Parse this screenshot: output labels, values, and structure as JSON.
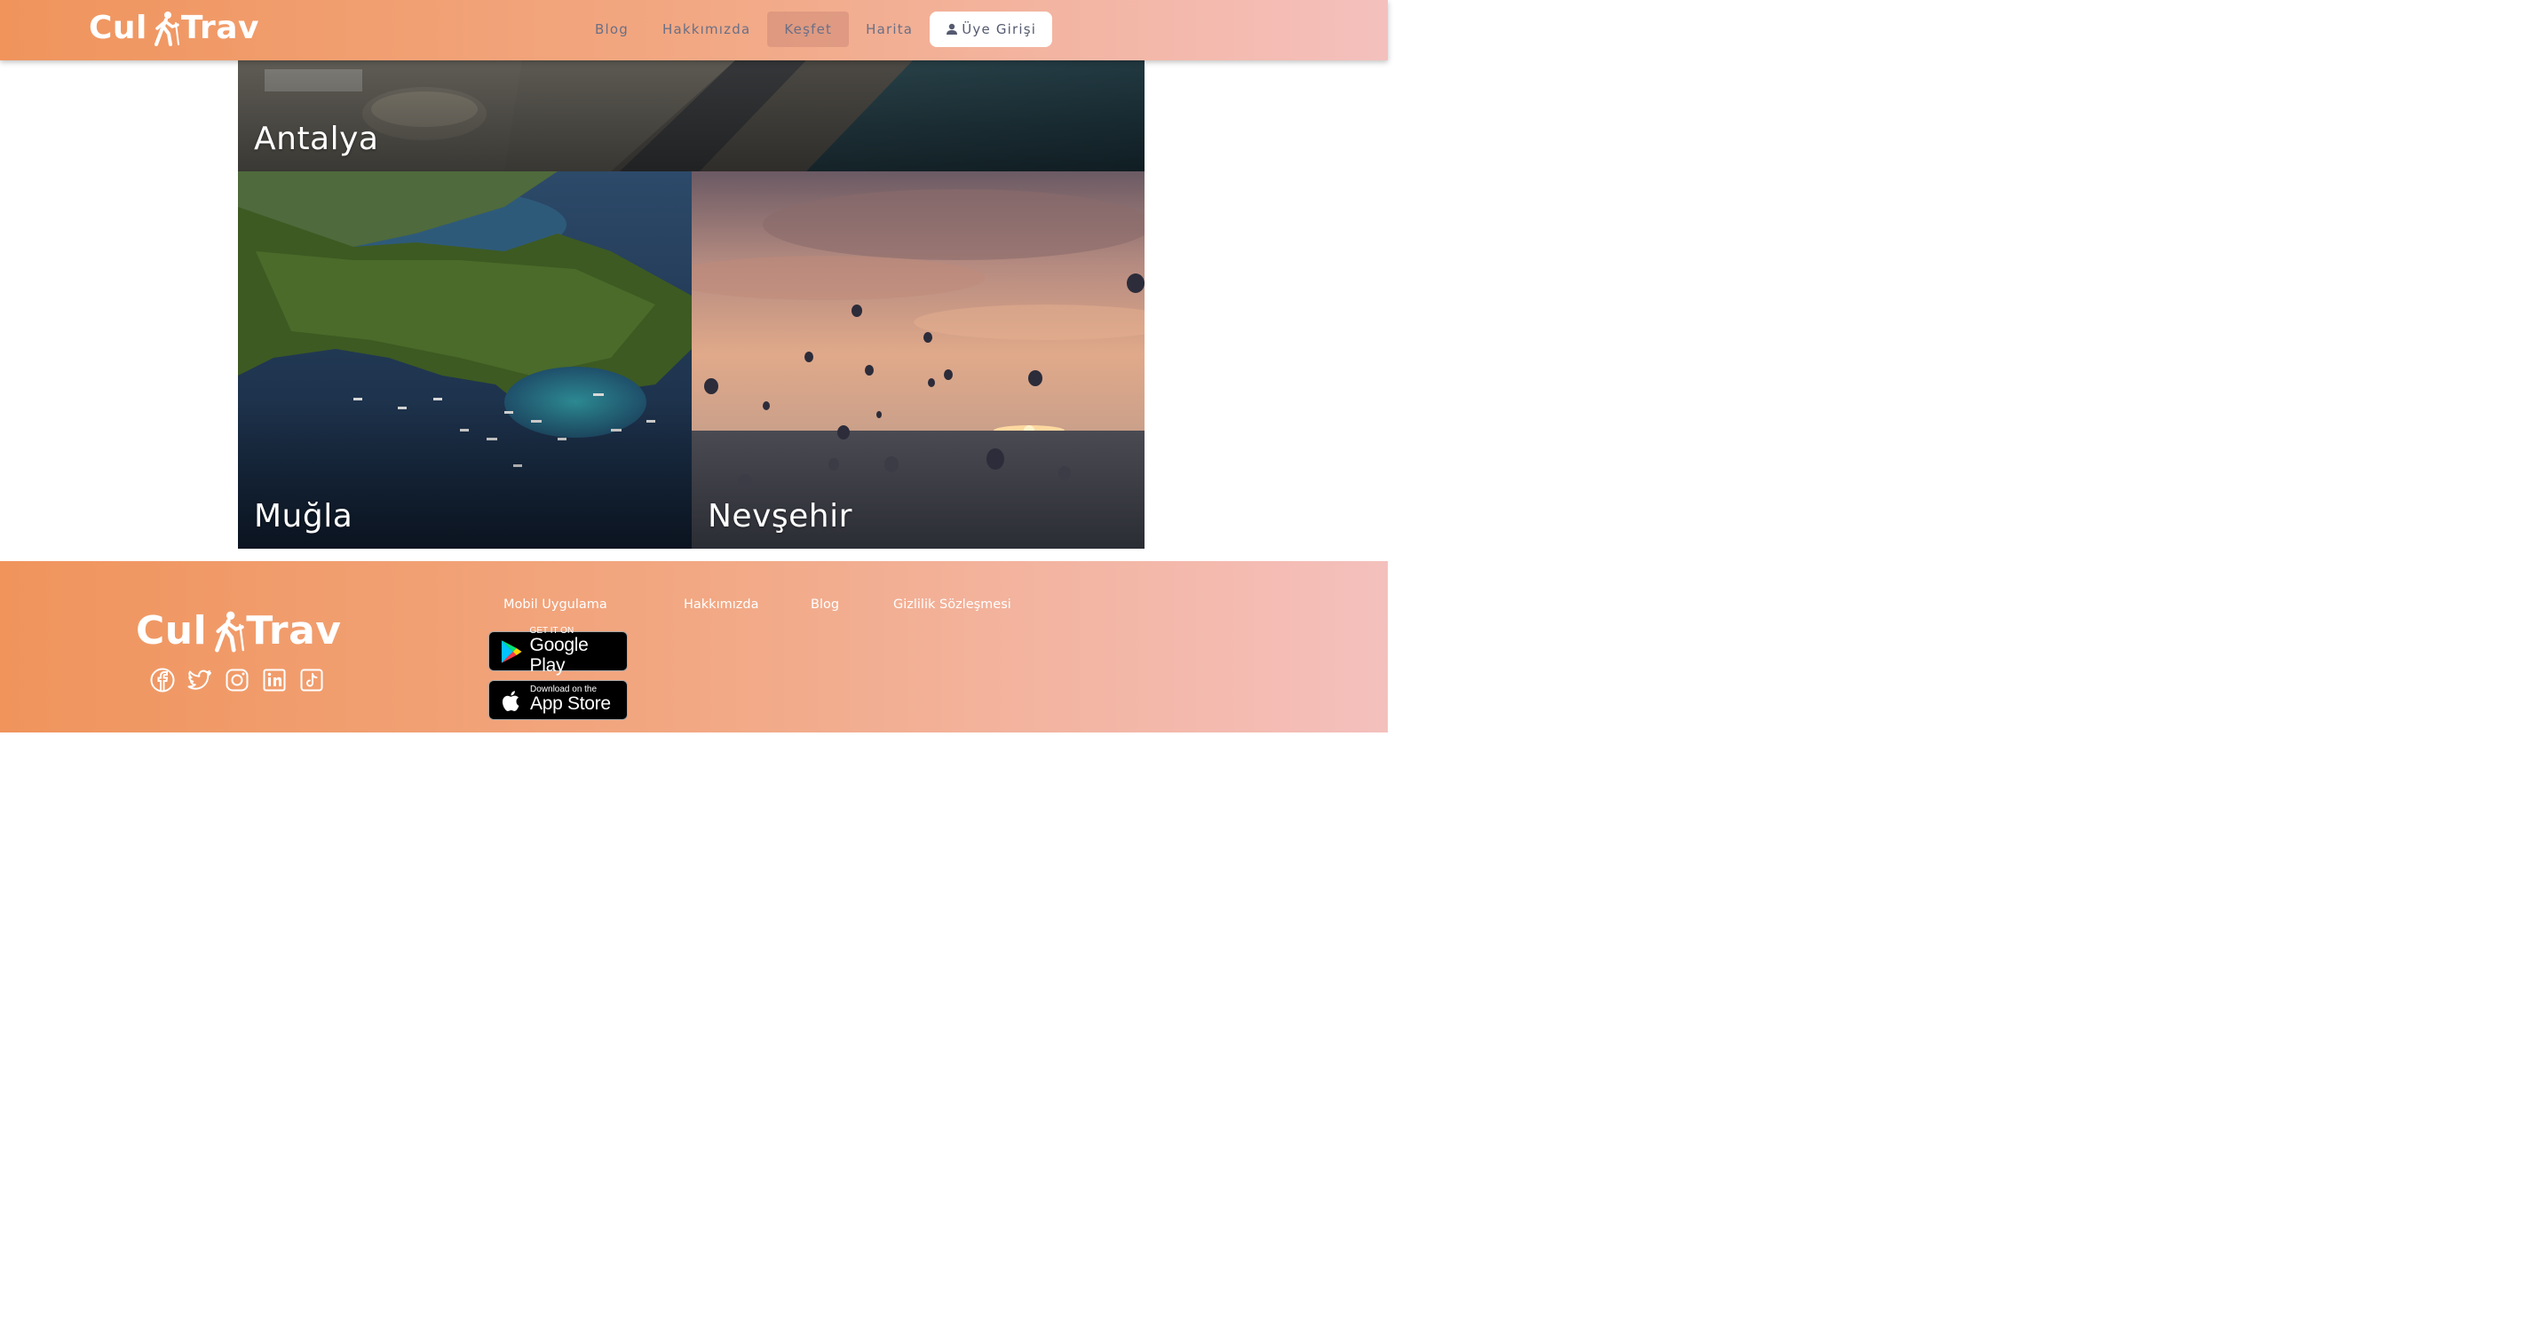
{
  "header": {
    "logo_left": "Cul",
    "logo_right": "Trav",
    "nav": [
      {
        "label": "Blog",
        "active": false
      },
      {
        "label": "Hakkımızda",
        "active": false
      },
      {
        "label": "Keşfet",
        "active": true
      },
      {
        "label": "Harita",
        "active": false
      }
    ],
    "login_label": "Üye Girişi"
  },
  "gallery": {
    "tiles": [
      {
        "label": "Antalya"
      },
      {
        "label": "Muğla"
      },
      {
        "label": "Nevşehir"
      }
    ]
  },
  "footer": {
    "logo_left": "Cul",
    "logo_right": "Trav",
    "socials": [
      "facebook-icon",
      "twitter-icon",
      "instagram-icon",
      "linkedin-icon",
      "tiktok-icon"
    ],
    "links": [
      "Mobil Uygulama",
      "Hakkımızda",
      "Blog",
      "Gizlilik Sözleşmesi"
    ],
    "google_play": {
      "small": "GET IT ON",
      "big": "Google Play"
    },
    "app_store": {
      "small": "Download on the",
      "big": "App Store"
    }
  },
  "colors": {
    "gradient_start": "#f0945c",
    "gradient_end": "#f4c0bd",
    "nav_text": "#6a6f86"
  }
}
